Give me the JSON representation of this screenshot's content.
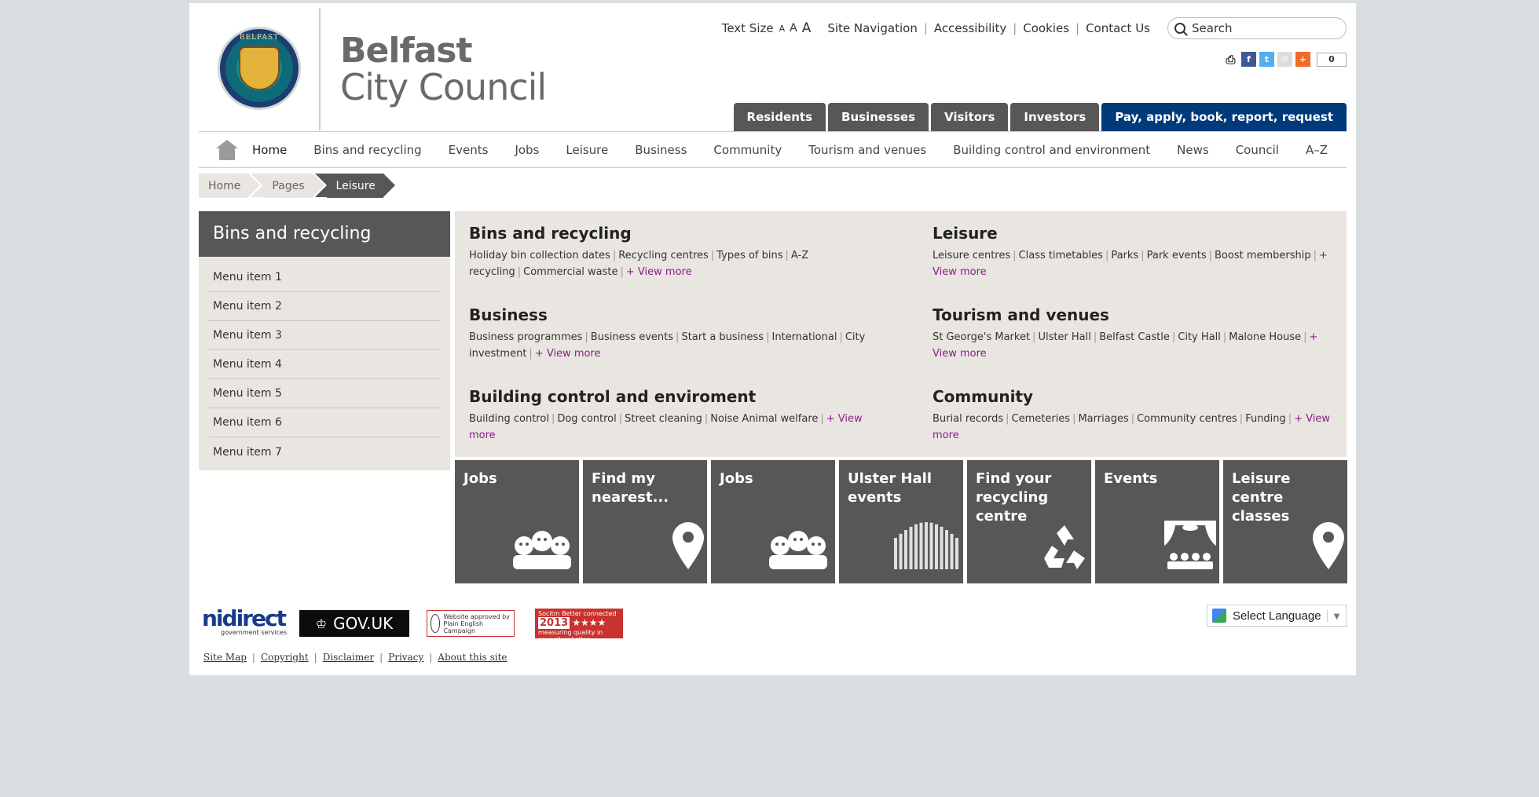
{
  "brand": {
    "line1": "Belfast",
    "line2": "City Council",
    "seal_text": "BELFAST"
  },
  "util": {
    "text_size_label": "Text Size",
    "sizes": [
      "A",
      "A",
      "A"
    ],
    "links": [
      "Site Navigation",
      "Accessibility",
      "Cookies",
      "Contact Us"
    ],
    "search_placeholder": "Search"
  },
  "share": {
    "count": "0"
  },
  "audience_tabs": [
    "Residents",
    "Businesses",
    "Visitors",
    "Investors"
  ],
  "primary_tab": "Pay, apply, book, report, request",
  "mainnav": [
    "Home",
    "Bins and recycling",
    "Events",
    "Jobs",
    "Leisure",
    "Business",
    "Community",
    "Tourism and venues",
    "Building control and environment",
    "News",
    "Council",
    "A–Z"
  ],
  "breadcrumb": [
    "Home",
    "Pages",
    "Leisure"
  ],
  "sidebar": {
    "title": "Bins and recycling",
    "items": [
      "Menu item 1",
      "Menu item 2",
      "Menu item 3",
      "Menu item 4",
      "Menu item 5",
      "Menu item 6",
      "Menu item 7"
    ]
  },
  "mega": [
    {
      "title": "Bins and recycling",
      "links": [
        "Holiday bin collection dates",
        "Recycling centres",
        "Types of bins",
        "A-Z recycling",
        "Commercial waste"
      ],
      "more": "+ View more"
    },
    {
      "title": "Leisure",
      "links": [
        "Leisure centres",
        "Class timetables",
        "Parks",
        "Park events",
        "Boost membership"
      ],
      "more": "+ View more"
    },
    {
      "title": "Business",
      "links": [
        "Business programmes",
        "Business events",
        "Start a business",
        "International",
        "City investment"
      ],
      "more": "+ View more"
    },
    {
      "title": "Tourism and venues",
      "links": [
        "St George's Market",
        "Ulster Hall",
        "Belfast Castle",
        "City Hall",
        "Malone House"
      ],
      "more": "+ View more"
    },
    {
      "title": "Building control and enviroment",
      "links": [
        "Building control",
        "Dog control",
        "Street cleaning",
        "Noise Animal welfare"
      ],
      "more": "+ View more"
    },
    {
      "title": "Community",
      "links": [
        "Burial records",
        "Cemeteries",
        "Marriages",
        "Community centres",
        "Funding"
      ],
      "more": "+ View more"
    }
  ],
  "tiles": [
    {
      "label": "Jobs",
      "icon": "people-icon"
    },
    {
      "label": "Find my nearest...",
      "icon": "map-pin-icon"
    },
    {
      "label": "Jobs",
      "icon": "people-icon"
    },
    {
      "label": "Ulster Hall events",
      "icon": "organ-icon"
    },
    {
      "label": "Find your recycling centre",
      "icon": "recycle-icon"
    },
    {
      "label": "Events",
      "icon": "theatre-icon"
    },
    {
      "label": "Leisure centre classes",
      "icon": "map-pin-icon"
    }
  ],
  "footer": {
    "nidirect": "nidirect",
    "nidirect_sub": "government services",
    "govuk": "GOV.UK",
    "pec": "Website approved by Plain English Campaign",
    "socitm": "Socitm Better connected",
    "socitm_year": "2013",
    "socitm_sub": "measuring quality in council websites",
    "language": "Select Language",
    "links": [
      "Site Map",
      "Copyright",
      "Disclaimer",
      "Privacy",
      "About this site"
    ]
  },
  "colors": {
    "tab_dark": "#575757",
    "tab_primary": "#003a7a",
    "panel": "#e9e6e1",
    "link_more": "#8a1d8a",
    "background": "#d9dfe1"
  }
}
